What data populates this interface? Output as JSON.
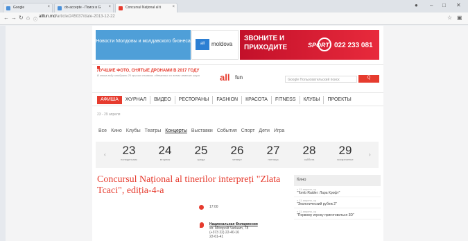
{
  "browser": {
    "tabs": [
      {
        "title": "Google",
        "favicon_color": "#4a90d9",
        "active": false
      },
      {
        "title": "do-accepte - Поиск в G",
        "favicon_color": "#4a90d9",
        "active": false
      },
      {
        "title": "Concursul Național al ti",
        "favicon_color": "#e63b2e",
        "active": true
      }
    ],
    "url_host": "allfun.md",
    "url_path": "/article/245037/date-2013-12-22"
  },
  "ads": {
    "ad1_text": "Новости Молдовы и молдавского бизнеса",
    "moldova_logo": "all",
    "moldova_text": "moldova",
    "ad3_line1": "ЗВОНИТЕ И",
    "ad3_line2": "ПРИХОДИТЕ",
    "ad3_brand": "SPORT",
    "ad3_phone": "022 233 081"
  },
  "promo": {
    "title": "ЛУЧШИЕ ФОТО, СНЯТЫЕ ДРОНАМИ В 2017 ГОДУ",
    "desc": "В этом году отобрано 20 лучших снимков, сделанных со всеми земного шара"
  },
  "logo": {
    "all": "all",
    "fun": "fun"
  },
  "search": {
    "placeholder": "Google Пользовательский поиск",
    "button": "Q"
  },
  "nav": [
    "АФИША",
    "ЖУРНАЛ",
    "ВИДЕО",
    "РЕСТОРАНЫ",
    "FASHION",
    "КРАСОТА",
    "FITNESS",
    "КЛУБЫ",
    "ПРОЕКТЫ"
  ],
  "date_range": "23 - 29 апреля",
  "categories": [
    "Все",
    "Кино",
    "Клубы",
    "Театры",
    "Концерты",
    "Выставки",
    "События",
    "Спорт",
    "Дети",
    "Игра"
  ],
  "days": [
    {
      "n": "23",
      "w": "понедельник"
    },
    {
      "n": "24",
      "w": "вторник"
    },
    {
      "n": "25",
      "w": "среда"
    },
    {
      "n": "26",
      "w": "четверг"
    },
    {
      "n": "27",
      "w": "пятница"
    },
    {
      "n": "28",
      "w": "суббота"
    },
    {
      "n": "29",
      "w": "воскресенье"
    }
  ],
  "event": {
    "title": "Concursul Național al tinerilor interpreți \"Zlata Tcaci\", ediția-4-a",
    "time": "17:00",
    "venue_name": "Национальная Филармония",
    "venue_addr": "str. Mitropolit Varlaam, 78",
    "venue_phone": "(+373 22) 22-40-16",
    "venue_phone2": "22-61-41"
  },
  "sidebar": {
    "heading": "Кино",
    "items": [
      {
        "date": "» 11 апреля, ср",
        "title": "\"Tomb Raider: Лара Крофт\""
      },
      {
        "date": "» 11 апреля, ср",
        "title": "\"Экологический рубеж 2\""
      },
      {
        "date": "» 11 апреля, ср",
        "title": "\"Первому игроку приготовиться 3D\""
      }
    ]
  }
}
